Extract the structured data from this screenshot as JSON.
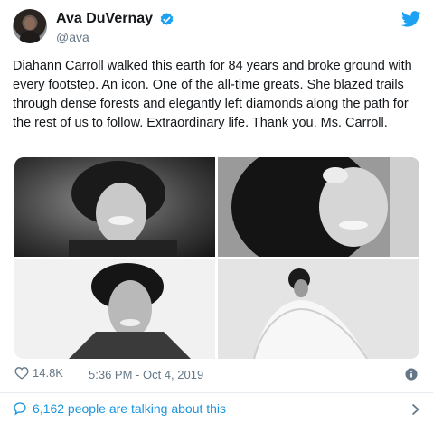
{
  "author": {
    "display_name": "Ava DuVernay",
    "handle": "@ava"
  },
  "tweet": {
    "text": "Diahann Carroll walked this earth for 84 years and broke ground with every footstep. An icon. One of the all-time greats. She blazed trails through dense forests and elegantly left diamonds along the path for the rest of us to follow. Extraordinary life. Thank you, Ms. Carroll."
  },
  "media": {
    "photos": [
      {
        "icon": "portrait-photo"
      },
      {
        "icon": "portrait-photo"
      },
      {
        "icon": "portrait-photo"
      },
      {
        "icon": "portrait-photo"
      }
    ]
  },
  "meta": {
    "like_count": "14.8K",
    "timestamp": "5:36 PM - Oct 4, 2019"
  },
  "footer": {
    "talking_label": "6,162 people are talking about this"
  },
  "colors": {
    "accent": "#1da1f2",
    "link": "#1b95e0",
    "secondary_text": "#657786"
  }
}
